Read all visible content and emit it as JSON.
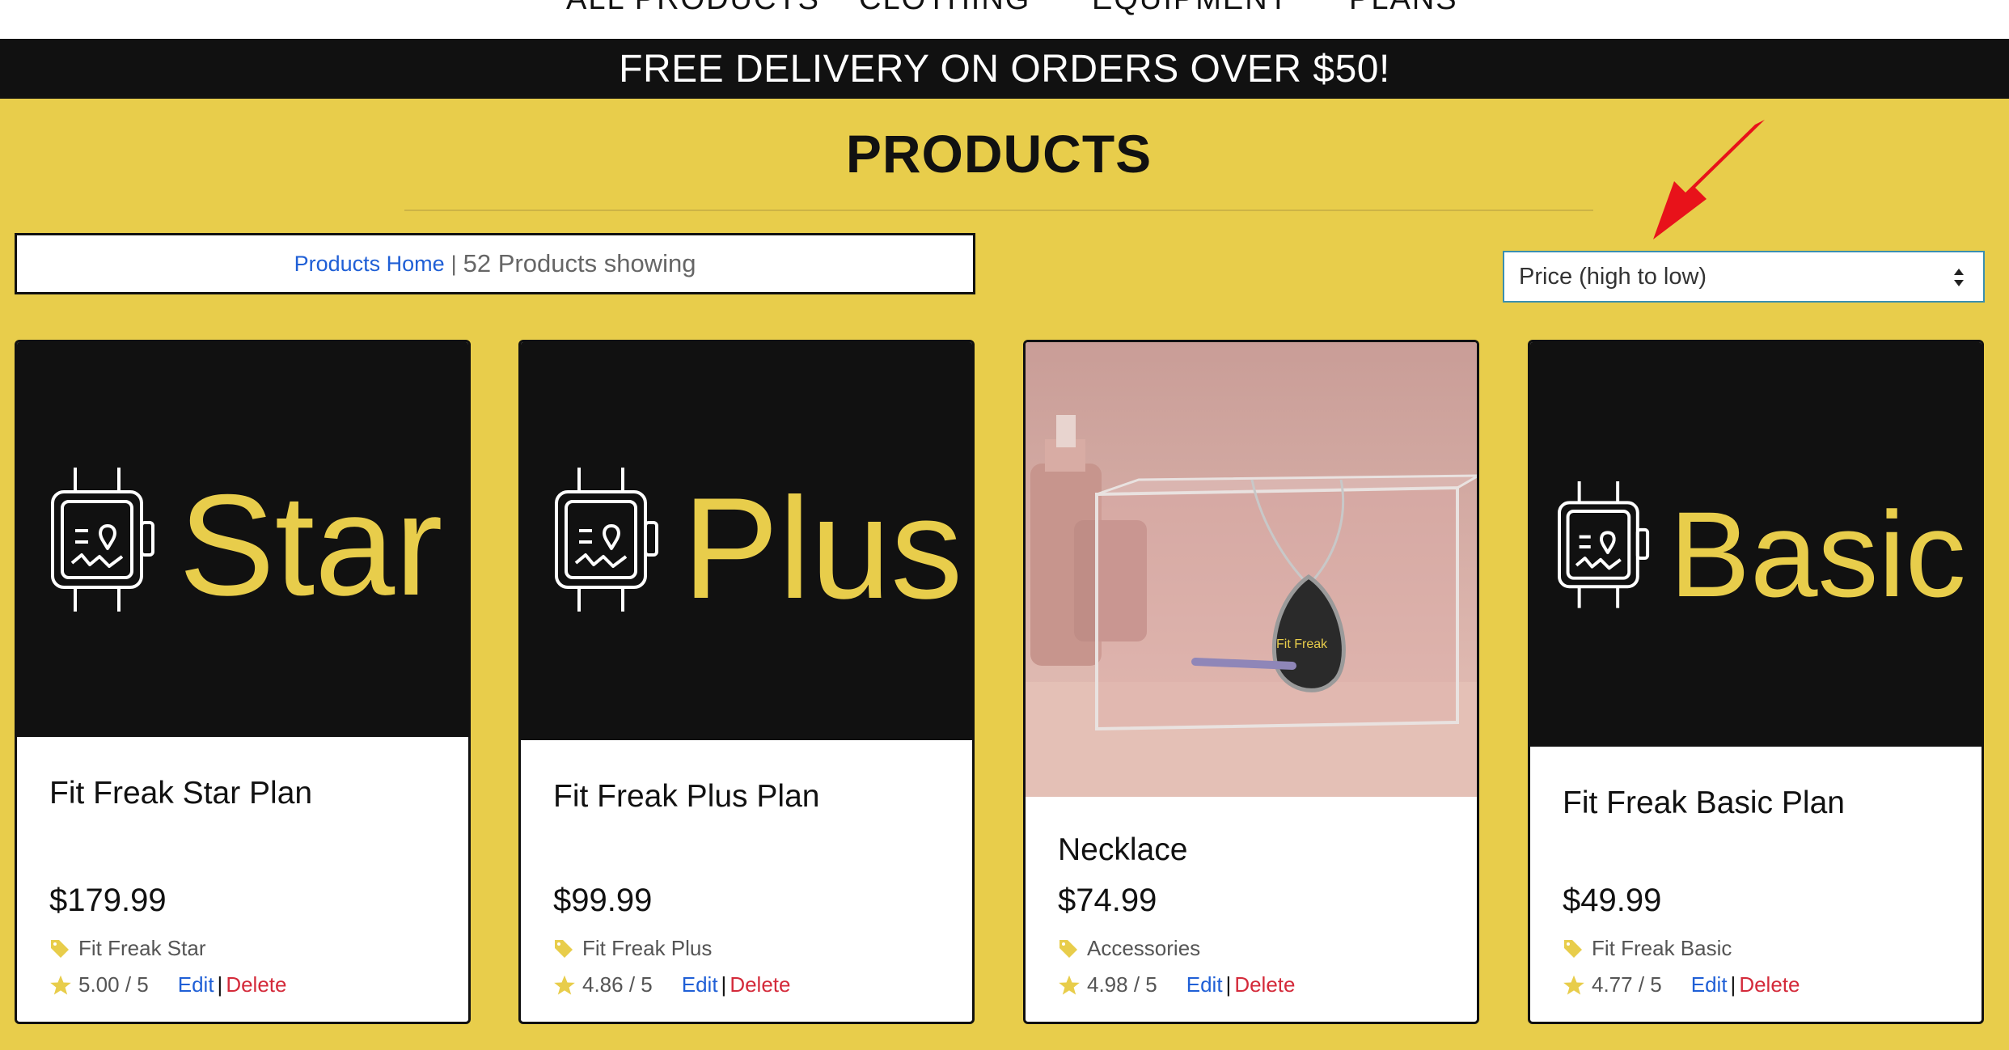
{
  "nav": {
    "items": [
      "All Products",
      "Clothing",
      "Equipment",
      "Plans"
    ]
  },
  "banner": {
    "text": "FREE DELIVERY ON ORDERS OVER $50!"
  },
  "page": {
    "title": "PRODUCTS"
  },
  "breadcrumb": {
    "home_label": "Products Home",
    "separator": "|",
    "count_text": "52 Products showing"
  },
  "sort": {
    "selected": "Price (high to low)"
  },
  "products": [
    {
      "name": "Fit Freak Star Plan",
      "price": "$179.99",
      "category": "Fit Freak Star",
      "rating": "5.00 / 5",
      "edit_label": "Edit",
      "sep": "|",
      "delete_label": "Delete",
      "image_word": "Star",
      "image_type": "logo"
    },
    {
      "name": "Fit Freak Plus Plan",
      "price": "$99.99",
      "category": "Fit Freak Plus",
      "rating": "4.86 / 5",
      "edit_label": "Edit",
      "sep": "|",
      "delete_label": "Delete",
      "image_word": "Plus",
      "image_type": "logo"
    },
    {
      "name": "Necklace",
      "price": "$74.99",
      "category": "Accessories",
      "rating": "4.98 / 5",
      "edit_label": "Edit",
      "sep": "|",
      "delete_label": "Delete",
      "image_word": "Fit Freak",
      "image_type": "photo"
    },
    {
      "name": "Fit Freak Basic Plan",
      "price": "$49.99",
      "category": "Fit Freak Basic",
      "rating": "4.77 / 5",
      "edit_label": "Edit",
      "sep": "|",
      "delete_label": "Delete",
      "image_word": "Basic",
      "image_type": "logo"
    }
  ],
  "colors": {
    "background": "#e8cd4b",
    "brand_yellow": "#e8cd4b",
    "black": "#111111",
    "link_blue": "#1f5fd6",
    "delete_red": "#d42a3a",
    "annotation_arrow": "#e8121a"
  },
  "icons": {
    "category": "tag-icon",
    "rating": "star-icon",
    "plan_logo": "smartwatch-heart-icon",
    "sort": "up-down-caret-icon",
    "annotation": "red-arrow-icon"
  }
}
